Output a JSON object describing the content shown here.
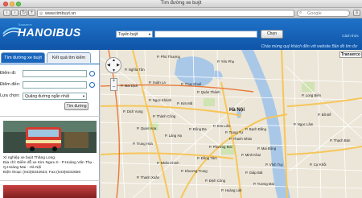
{
  "browser": {
    "window_title": "Tìm đường xe buýt",
    "tab_label": "Tìm đường xe buýt",
    "url": "www.timbuyt.vn",
    "search_placeholder": "Google"
  },
  "header": {
    "logo": "HANOIBUS",
    "tagline": "Transerco",
    "search_select": "Tuyến buýt",
    "search_button": "Chọn",
    "welcome": "Chào mừng quý khách đến với website Bản đồ tìm đư",
    "links": "Cách thức"
  },
  "tabs": {
    "active": "Tìm đường xe buýt",
    "inactive": "Kết quả tìm kiếm"
  },
  "form": {
    "from_label": "Điểm đi:",
    "to_label": "Điểm đến:",
    "option_label": "Lựa chọn:",
    "option_value": "Quãng đường ngắn nhất",
    "submit": "Tìm đường"
  },
  "company": {
    "name": "Xí nghiệp xe buýt Thăng Long",
    "address1": "Địa chỉ: Điểm đỗ xe Kim Ngưu II - P.Hoàng Văn Thụ -",
    "address2": "Q.Hoàng Mai - Hà Nội",
    "phone": "Điện thoại: (043)6342634; Fax:(043)6342656"
  },
  "map": {
    "transerco": "Transerco",
    "zoom_in": "+",
    "zoom_out": "–",
    "center_label": "Hà Nội",
    "labels": [
      "P. Nghĩa Tân",
      "P. Yên Phụ",
      "P. Quán Thánh",
      "P. Ngọc Khánh",
      "P. Kim Mã",
      "P. Thành Công",
      "P. Đống Đa",
      "P. Láng Hạ",
      "P. Trung Hòa",
      "P. Nhân Chính",
      "P. Khương Trung",
      "P. Phương Mai",
      "P. Bạch Đằng",
      "P. Minh Khai",
      "P. Thanh Nhàn",
      "P. Đồng Tâm",
      "P. Định Công",
      "P. Hoàng Liệt",
      "P. Long Biên",
      "P. Ngọc Lâm",
      "P. Bồ Đề",
      "P. Cự Khối",
      "P. Thạch Bàn",
      "P. Giáp Bát",
      "P. Tương Mai",
      "P. Mai Động",
      "P. Vĩnh Tuy",
      "P. Thanh Xuân",
      "P. Mai Dịch",
      "P. Quan Hoa",
      "P. Dịch Vọng",
      "P. Phú Thượng",
      "P. Xuân La",
      "P. Thụy Khuê",
      "P. Kim Liên",
      "P. Trung Tự"
    ]
  },
  "colors": {
    "header_blue": "#1a66bd",
    "map_bg": "#ece6d8",
    "road_main": "#f6c65a",
    "water": "#a9c8e8"
  }
}
